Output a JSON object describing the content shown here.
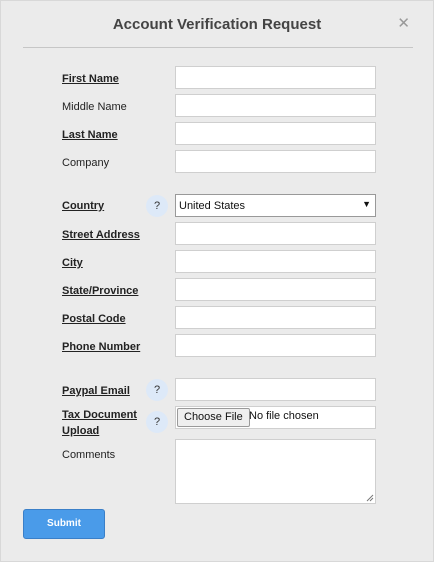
{
  "dialog": {
    "title": "Account Verification Request",
    "close_glyph": "✕"
  },
  "fields": {
    "first_name": {
      "label": "First Name",
      "value": ""
    },
    "middle_name": {
      "label": "Middle Name",
      "value": ""
    },
    "last_name": {
      "label": "Last Name",
      "value": ""
    },
    "company": {
      "label": "Company",
      "value": ""
    },
    "country": {
      "label": "Country",
      "value": "United States"
    },
    "street_address": {
      "label": "Street Address",
      "value": ""
    },
    "city": {
      "label": "City",
      "value": ""
    },
    "state_province": {
      "label": "State/Province",
      "value": ""
    },
    "postal_code": {
      "label": "Postal Code",
      "value": ""
    },
    "phone_number": {
      "label": "Phone Number",
      "value": ""
    },
    "paypal_email": {
      "label": "Paypal Email",
      "value": ""
    },
    "tax_document": {
      "label_line1": "Tax Document",
      "label_line2": "Upload",
      "button": "Choose File",
      "status": "No file chosen"
    },
    "comments": {
      "label": "Comments",
      "value": ""
    }
  },
  "help_glyph": "?",
  "dropdown_arrow": "▼",
  "submit_label": "Submit",
  "icons": {
    "help": "question-mark-icon",
    "close": "close-icon",
    "dropdown": "chevron-down-icon"
  },
  "colors": {
    "submit": "#4a9be9",
    "help_bg": "#dde9f8"
  }
}
